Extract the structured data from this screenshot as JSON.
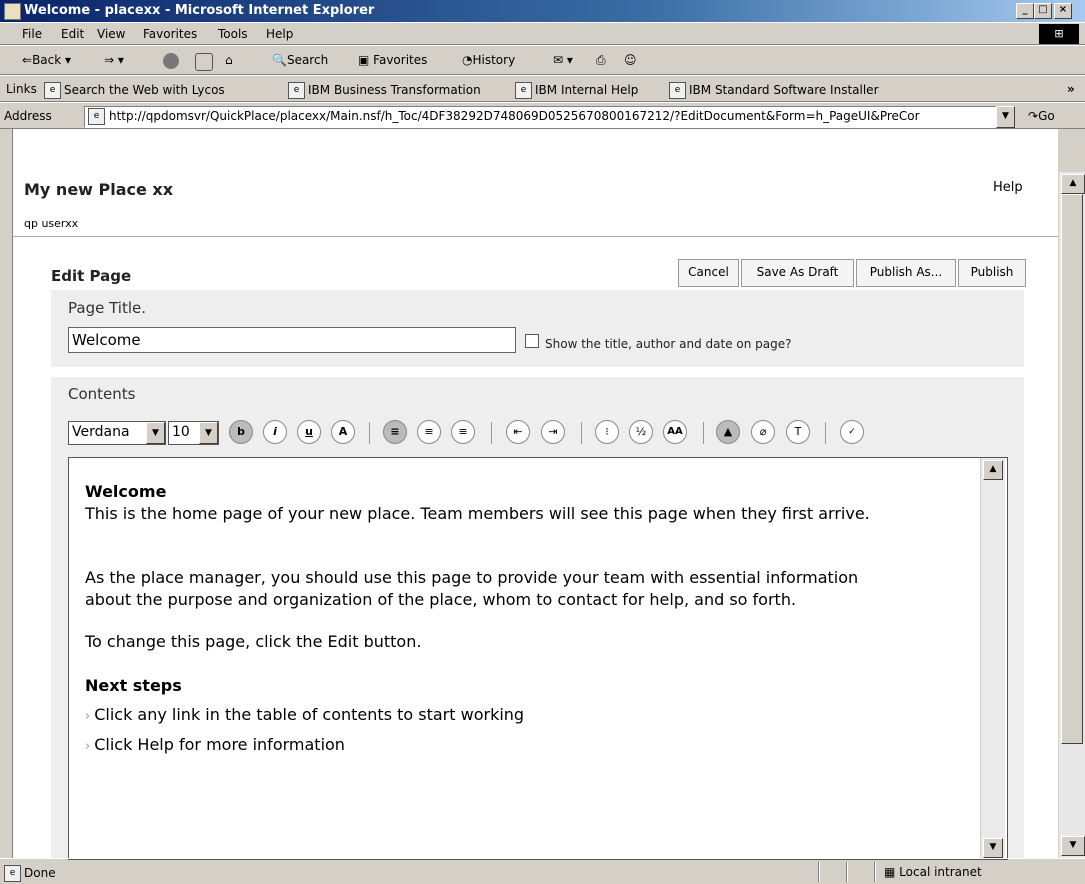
{
  "window": {
    "title": "Welcome - placexx - Microsoft Internet Explorer"
  },
  "menu": [
    "File",
    "Edit",
    "View",
    "Favorites",
    "Tools",
    "Help"
  ],
  "toolbar": {
    "back": "Back",
    "search": "Search",
    "favorites": "Favorites",
    "history": "History"
  },
  "links": {
    "label": "Links",
    "items": [
      "Search the Web with Lycos",
      "IBM Business Transformation",
      "IBM Internal Help",
      "IBM Standard Software Installer"
    ],
    "more": "»"
  },
  "address": {
    "label": "Address",
    "url": "http://qpdomsvr/QuickPlace/placexx/Main.nsf/h_Toc/4DF38292D748069D0525670800167212/?EditDocument&Form=h_PageUI&PreCor",
    "go": "Go"
  },
  "page": {
    "place_title": "My new Place xx",
    "help_link": "Help",
    "user": "qp userxx",
    "edit_heading": "Edit Page",
    "buttons": {
      "cancel": "Cancel",
      "save_draft": "Save As Draft",
      "publish_as": "Publish As...",
      "publish": "Publish"
    },
    "title_label": "Page Title.",
    "title_value": "Welcome",
    "show_title_label": "Show the title, author and date on page?",
    "contents_label": "Contents",
    "font_family": "Verdana",
    "font_size": "10"
  },
  "editor": {
    "heading": "Welcome",
    "intro": "This is the home page of your new place. Team members will see this page when they first arrive.",
    "para1_line1": "As the place manager, you should use this page to provide your team with essential information",
    "para1_line2": "about the purpose and organization of the place, whom to contact for help, and so forth.",
    "para2": "To change this page, click the Edit button.",
    "next_heading": "Next steps",
    "steps": [
      "Click any link in the table of contents to start working",
      "Click Help for more information"
    ]
  },
  "status": {
    "text": "Done",
    "zone": "Local intranet"
  }
}
